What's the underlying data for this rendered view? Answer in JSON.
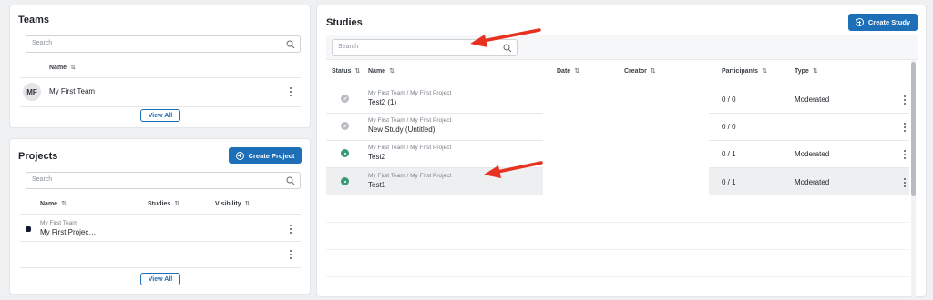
{
  "teams": {
    "title": "Teams",
    "search_placeholder": "Search",
    "column_name": "Name",
    "sort_glyph": "⇅",
    "rows": [
      {
        "avatar": "MF",
        "name": "My First Team"
      }
    ],
    "view_all": "View All"
  },
  "projects": {
    "title": "Projects",
    "create_label": "Create Project",
    "search_placeholder": "Search",
    "columns": [
      "Name",
      "Studies",
      "Visibility"
    ],
    "sort_glyph": "⇅",
    "rows": [
      {
        "team": "My First Team",
        "name": "My First Projec…"
      }
    ],
    "view_all": "View All"
  },
  "studies": {
    "title": "Studies",
    "create_label": "Create Study",
    "search_placeholder": "Search",
    "sort_glyph": "⇅",
    "columns": [
      "Status",
      "Name",
      "Date",
      "Creator",
      "Participants",
      "Type"
    ],
    "rows": [
      {
        "status": "grey",
        "path": "My First Team / My First Project",
        "name": "Test2 (1)",
        "participants": "0 / 0",
        "type": "Moderated"
      },
      {
        "status": "grey",
        "path": "My First Team / My First Project",
        "name": "New Study (Untitled)",
        "participants": "0 / 0",
        "type": ""
      },
      {
        "status": "green",
        "path": "My First Team / My First Project",
        "name": "Test2",
        "participants": "0 / 1",
        "type": "Moderated"
      },
      {
        "status": "green",
        "path": "My First Team / My First Project",
        "name": "Test1",
        "participants": "0 / 1",
        "type": "Moderated"
      }
    ]
  },
  "colors": {
    "accent": "#1d6fb8",
    "annotation_arrow": "#e8321f",
    "status_active": "#3a9a74",
    "status_draft": "#b9bcc0"
  }
}
